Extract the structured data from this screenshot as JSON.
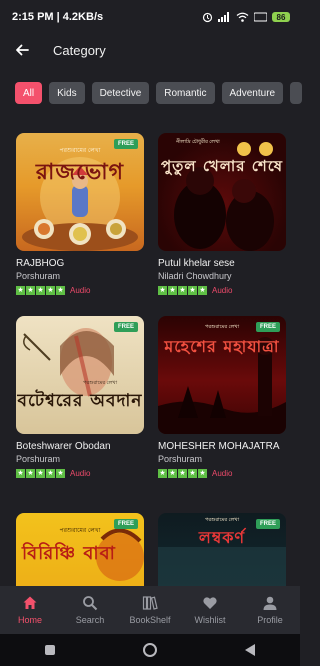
{
  "status_bar": {
    "time_speed": "2:15 PM | 4.2KB/s",
    "battery": "86"
  },
  "app_bar": {
    "title": "Category"
  },
  "filters": [
    "All",
    "Kids",
    "Detective",
    "Romantic",
    "Adventure"
  ],
  "books": [
    {
      "title": "RAJBHOG",
      "author": "Porshuram",
      "badge": "FREE",
      "format": "Audio",
      "cover_author": "পরশুরামের লেখা",
      "cover_title": "রাজভোগ",
      "rating": 5
    },
    {
      "title": "Putul khelar sese",
      "author": "Niladri Chowdhury",
      "badge": "FREE",
      "format": "Audio",
      "cover_author": "নীলাদ্রি চৌধুরীর লেখা",
      "cover_title": "পুতুল খেলার শেষে",
      "rating": 5
    },
    {
      "title": "Boteshwarer Obodan",
      "author": "Porshuram",
      "badge": "FREE",
      "format": "Audio",
      "cover_author": "পরশুরামের লেখা",
      "cover_title": "বটেশ্বরের অবদান",
      "rating": 5
    },
    {
      "title": "MOHESHER MOHAJATRA",
      "author": "Porshuram",
      "badge": "FREE",
      "format": "Audio",
      "cover_author": "পরশুরামের লেখা",
      "cover_title": "মহেশের মহাযাত্রা",
      "rating": 5
    },
    {
      "title": "",
      "author": "",
      "badge": "FREE",
      "format": "",
      "cover_author": "পরশুরামের লেখা",
      "cover_title": "বিরিঞ্চি বাবা",
      "rating": 0
    },
    {
      "title": "",
      "author": "",
      "badge": "FREE",
      "format": "",
      "cover_author": "পরশুরামের লেখা",
      "cover_title": "লম্বকর্ণ",
      "rating": 0
    }
  ],
  "nav": [
    "Home",
    "Search",
    "BookShelf",
    "Wishlist",
    "Profile"
  ],
  "colors": {
    "accent": "#f4516c",
    "free_badge": "#2f9e58",
    "star": "#5fbf45"
  }
}
